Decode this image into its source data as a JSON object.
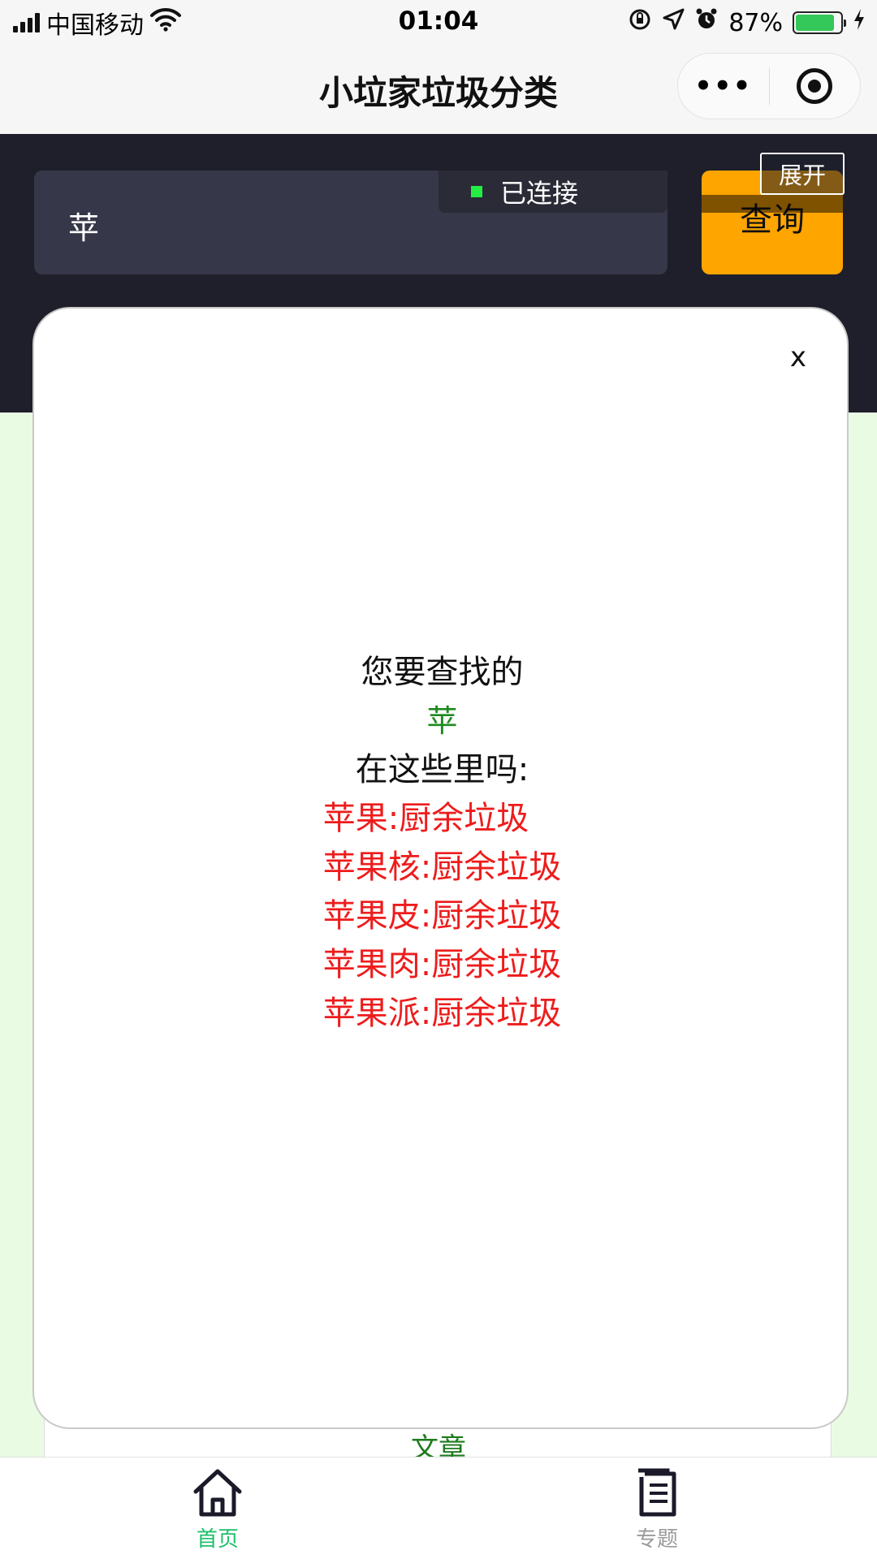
{
  "status_bar": {
    "carrier": "中国移动",
    "time": "01:04",
    "battery_percent": "87%",
    "battery_level": 0.87,
    "icons": [
      "signal-icon",
      "wifi-icon",
      "orientation-lock-icon",
      "location-icon",
      "alarm-icon",
      "battery-icon",
      "charging-icon"
    ]
  },
  "nav": {
    "title": "小垃家垃圾分类",
    "more_label": "•••",
    "icons": [
      "more-icon",
      "target-icon"
    ]
  },
  "search": {
    "value": "苹",
    "query_button": "查询"
  },
  "overlay": {
    "connection_status": "已连接",
    "expand_button": "展开",
    "status_color": "#22ee44"
  },
  "modal": {
    "close_label": "x",
    "prompt_line1": "您要查找的",
    "keyword": "苹",
    "prompt_line2": "在这些里吗:",
    "results": [
      "苹果:厨余垃圾",
      "苹果核:厨余垃圾",
      "苹果皮:厨余垃圾",
      "苹果肉:厨余垃圾",
      "苹果派:厨余垃圾"
    ],
    "keyword_color": "#1f8a1f",
    "result_color": "#ee1c1c"
  },
  "background_card": {
    "text": "文章"
  },
  "tab_bar": {
    "tabs": [
      {
        "label": "首页",
        "icon": "home-icon",
        "active": true
      },
      {
        "label": "专题",
        "icon": "document-icon",
        "active": false
      }
    ],
    "active_color": "#1fbf6a",
    "inactive_color": "#9a9a9a"
  },
  "colors": {
    "header_bg": "#1e1f2a",
    "search_bg": "#363748",
    "query_button_bg": "#ffa500",
    "page_bg": "#eafbe3"
  }
}
